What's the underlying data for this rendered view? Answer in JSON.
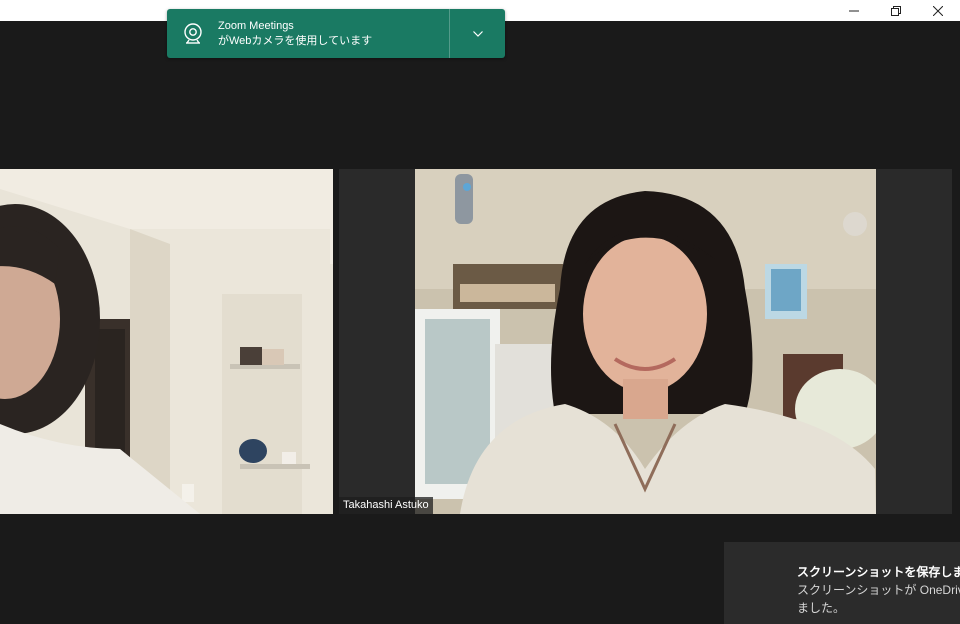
{
  "window": {
    "controls": {
      "minimize_icon": "minimize-icon",
      "restore_icon": "restore-icon",
      "close_icon": "close-icon"
    }
  },
  "camera_notice": {
    "line1": "Zoom Meetings",
    "line2": "がWebカメラを使用しています",
    "icon": "webcam-icon",
    "expand_icon": "chevron-down-icon",
    "color": "#1a7a63"
  },
  "participants": [
    {
      "name": ""
    },
    {
      "name": "Takahashi Astuko"
    }
  ],
  "toast": {
    "title": "スクリーンショットを保存しました",
    "line1": "スクリーンショットが OneDrive",
    "line2": "ました。"
  }
}
